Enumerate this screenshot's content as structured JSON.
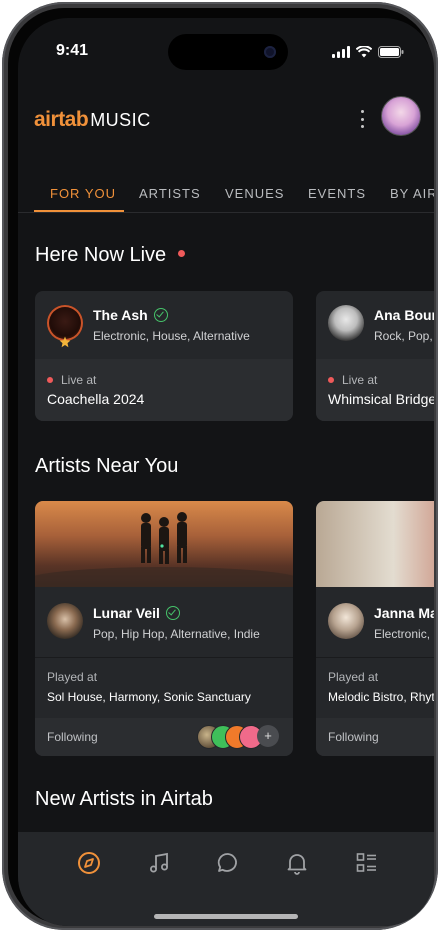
{
  "status_bar": {
    "time": "9:41"
  },
  "app": {
    "logo_air": "air",
    "logo_tab": "tab",
    "logo_music": "MUSIC"
  },
  "tabs": [
    {
      "label": "FOR YOU",
      "active": true
    },
    {
      "label": "ARTISTS"
    },
    {
      "label": "VENUES"
    },
    {
      "label": "EVENTS"
    },
    {
      "label": "BY AIRTAB"
    }
  ],
  "sections": {
    "here_now_live": "Here Now Live",
    "artists_near_you": "Artists Near You",
    "new_artists": "New Artists in Airtab"
  },
  "live_cards": [
    {
      "name": "The Ash",
      "verified": true,
      "genres": "Electronic, House, Alternative",
      "live_label": "Live at",
      "venue": "Coachella 2024"
    },
    {
      "name": "Ana Bourne",
      "verified": false,
      "genres": "Rock, Pop, Indie",
      "live_label": "Live at",
      "venue": "Whimsical Bridge"
    }
  ],
  "artist_cards": [
    {
      "name": "Lunar Veil",
      "verified": true,
      "genres": "Pop, Hip Hop, Alternative, Indie",
      "played_label": "Played at",
      "played_venues": "Sol House, Harmony, Sonic Sanctuary",
      "following_label": "Following",
      "more": "+"
    },
    {
      "name": "Janna Marie",
      "verified": false,
      "genres": "Electronic, Pop",
      "played_label": "Played at",
      "played_venues": "Melodic Bistro, Rhythm Room",
      "following_label": "Following"
    }
  ],
  "colors": {
    "accent": "#f0913a",
    "live_red": "#ef5a5a",
    "verified_green": "#46c36a",
    "background": "#131416",
    "card": "#25272a"
  },
  "bottom_nav": [
    {
      "icon": "compass-icon",
      "active": true
    },
    {
      "icon": "music-note-icon"
    },
    {
      "icon": "chat-bubble-icon"
    },
    {
      "icon": "bell-icon"
    },
    {
      "icon": "list-icon"
    }
  ]
}
